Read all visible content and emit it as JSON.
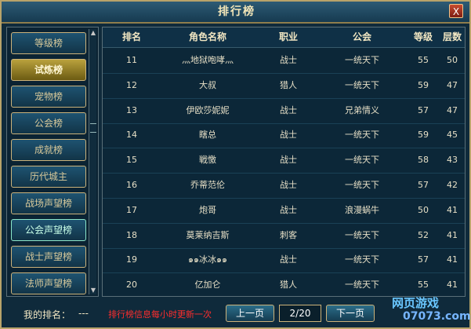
{
  "window": {
    "title": "排行榜",
    "close_glyph": "X"
  },
  "sidebar": {
    "items": [
      {
        "label": "等级榜",
        "state": "normal"
      },
      {
        "label": "试炼榜",
        "state": "active"
      },
      {
        "label": "宠物榜",
        "state": "normal"
      },
      {
        "label": "公会榜",
        "state": "normal"
      },
      {
        "label": "成就榜",
        "state": "normal"
      },
      {
        "label": "历代城主",
        "state": "normal"
      },
      {
        "label": "战场声望榜",
        "state": "normal"
      },
      {
        "label": "公会声望榜",
        "state": "hover"
      },
      {
        "label": "战士声望榜",
        "state": "normal"
      },
      {
        "label": "法师声望榜",
        "state": "normal"
      }
    ]
  },
  "table": {
    "headers": [
      "排名",
      "角色名称",
      "职业",
      "公会",
      "等级",
      "层数"
    ],
    "rows": [
      [
        "11",
        "灬地狱咆哮灬",
        "战士",
        "一统天下",
        "55",
        "50"
      ],
      [
        "12",
        "大叔",
        "猎人",
        "一统天下",
        "59",
        "47"
      ],
      [
        "13",
        "伊欧莎妮妮",
        "战士",
        "兄弟情义",
        "57",
        "47"
      ],
      [
        "14",
        "瞎总",
        "战士",
        "一统天下",
        "59",
        "45"
      ],
      [
        "15",
        "戦憿",
        "战士",
        "一统天下",
        "58",
        "43"
      ],
      [
        "16",
        "乔蒂范伦",
        "战士",
        "一统天下",
        "57",
        "42"
      ],
      [
        "17",
        "炮哥",
        "战士",
        "浪漫蜗牛",
        "50",
        "41"
      ],
      [
        "18",
        "莫莱纳吉斯",
        "刺客",
        "一统天下",
        "52",
        "41"
      ],
      [
        "19",
        "๑๑冰冰๑๑",
        "战士",
        "一统天下",
        "57",
        "41"
      ],
      [
        "20",
        "亿加仑",
        "猎人",
        "一统天下",
        "55",
        "41"
      ]
    ]
  },
  "footer": {
    "my_rank_label": "我的排名：",
    "my_rank_value": "---",
    "notice": "排行榜信息每小时更新一次",
    "prev_label": "上一页",
    "page_value": "2/20",
    "next_label": "下一页"
  },
  "watermark": {
    "line1": "网页游戏",
    "line2": "07073.com"
  },
  "colors": {
    "accent_gold": "#cbb27a",
    "active_bg": "#b9a13d",
    "notice_red": "#ff2d2d"
  }
}
